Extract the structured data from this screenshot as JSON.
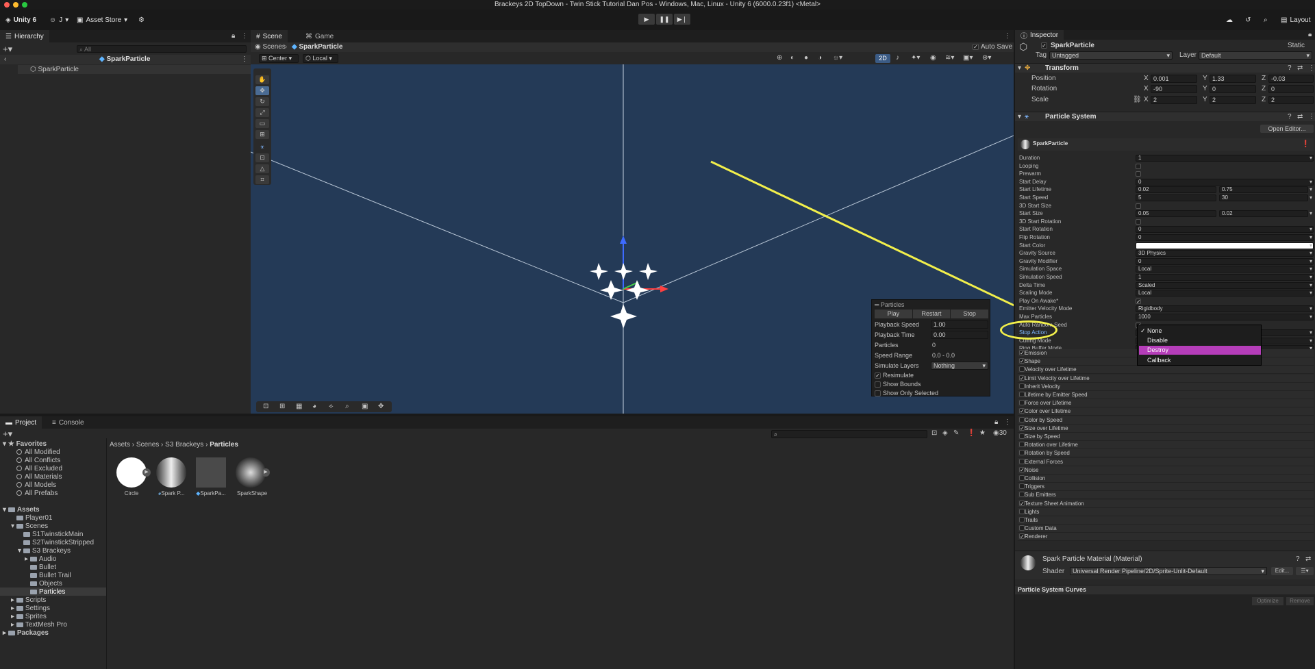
{
  "window": {
    "title": "Brackeys 2D TopDown - Twin Stick Tutorial Dan Pos - Windows, Mac, Linux - Unity 6 (6000.0.23f1) <Metal>"
  },
  "toolbar": {
    "app_label": "Unity 6",
    "account_label": "J",
    "asset_store_label": "Asset Store",
    "layout_label": "Layout"
  },
  "hierarchy": {
    "tab": "Hierarchy",
    "search_placeholder": "All",
    "scene_name": "SparkParticle",
    "item": "SparkParticle"
  },
  "scene": {
    "tabs": [
      "Scene",
      "Game"
    ],
    "breadcrumb_root": "Scenes",
    "breadcrumb_item": "SparkParticle",
    "auto_save": "Auto Save",
    "pivot": "Center",
    "space": "Local",
    "mode_2d": "2D"
  },
  "particles_overlay": {
    "title": "Particles",
    "buttons": [
      "Play",
      "Restart",
      "Stop"
    ],
    "rows": [
      {
        "label": "Playback Speed",
        "value": "1.00"
      },
      {
        "label": "Playback Time",
        "value": "0.00"
      },
      {
        "label": "Particles",
        "value": "0"
      },
      {
        "label": "Speed Range",
        "value": "0.0 - 0.0"
      },
      {
        "label": "Simulate Layers",
        "value": "Nothing"
      }
    ],
    "toggles": [
      {
        "label": "Resimulate",
        "checked": true
      },
      {
        "label": "Show Bounds",
        "checked": false
      },
      {
        "label": "Show Only Selected",
        "checked": false
      }
    ]
  },
  "project": {
    "tabs": [
      "Project",
      "Console"
    ],
    "search_count": "30",
    "favorites_label": "Favorites",
    "favorites": [
      "All Modified",
      "All Conflicts",
      "All Excluded",
      "All Materials",
      "All Models",
      "All Prefabs"
    ],
    "assets_label": "Assets",
    "tree": [
      "Player01",
      "Scenes",
      "S1TwinstickMain",
      "S2TwinstickStripped",
      "S3 Brackeys",
      "Audio",
      "Bullet",
      "Bullet Trail",
      "Objects",
      "Particles",
      "Scripts",
      "Settings",
      "Sprites",
      "TextMesh Pro"
    ],
    "packages_label": "Packages",
    "breadcrumb": [
      "Assets",
      "Scenes",
      "S3 Brackeys",
      "Particles"
    ],
    "assets": [
      "Circle",
      "Spark P...",
      "SparkPa...",
      "SparkShape"
    ]
  },
  "inspector": {
    "tab": "Inspector",
    "object_name": "SparkParticle",
    "static_label": "Static",
    "tag_label": "Tag",
    "tag_value": "Untagged",
    "layer_label": "Layer",
    "layer_value": "Default",
    "transform": {
      "title": "Transform",
      "rows": [
        {
          "label": "Position",
          "x": "0.001",
          "y": "1.33",
          "z": "-0.03"
        },
        {
          "label": "Rotation",
          "x": "-90",
          "y": "0",
          "z": "0"
        },
        {
          "label": "Scale",
          "x": "2",
          "y": "2",
          "z": "2"
        }
      ]
    },
    "particle_system": {
      "title": "Particle System",
      "open_editor": "Open Editor...",
      "sub_name": "SparkParticle",
      "props": [
        {
          "label": "Duration",
          "value": "1"
        },
        {
          "label": "Looping",
          "value": ""
        },
        {
          "label": "Prewarm",
          "value": ""
        },
        {
          "label": "Start Delay",
          "value": "0"
        },
        {
          "label": "Start Lifetime",
          "value": "0.02",
          "value2": "0.75"
        },
        {
          "label": "Start Speed",
          "value": "5",
          "value2": "30"
        },
        {
          "label": "3D Start Size",
          "value": ""
        },
        {
          "label": "Start Size",
          "value": "0.05",
          "value2": "0.02"
        },
        {
          "label": "3D Start Rotation",
          "value": ""
        },
        {
          "label": "Start Rotation",
          "value": "0"
        },
        {
          "label": "Flip Rotation",
          "value": "0"
        },
        {
          "label": "Start Color",
          "value": ""
        },
        {
          "label": "Gravity Source",
          "value": "3D Physics"
        },
        {
          "label": "Gravity Modifier",
          "value": "0"
        },
        {
          "label": "Simulation Space",
          "value": "Local"
        },
        {
          "label": "Simulation Speed",
          "value": "1"
        },
        {
          "label": "Delta Time",
          "value": "Scaled"
        },
        {
          "label": "Scaling Mode",
          "value": "Local"
        },
        {
          "label": "Play On Awake*",
          "value": "✓"
        },
        {
          "label": "Emitter Velocity Mode",
          "value": "Rigidbody"
        },
        {
          "label": "Max Particles",
          "value": "1000"
        },
        {
          "label": "Auto Random Seed",
          "value": "✓"
        },
        {
          "label": "Stop Action",
          "value": ""
        },
        {
          "label": "Culling Mode",
          "value": ""
        },
        {
          "label": "Ring Buffer Mode",
          "value": ""
        }
      ],
      "modules": [
        {
          "label": "Emission",
          "on": true
        },
        {
          "label": "Shape",
          "on": true
        },
        {
          "label": "Velocity over Lifetime",
          "on": false
        },
        {
          "label": "Limit Velocity over Lifetime",
          "on": true
        },
        {
          "label": "Inherit Velocity",
          "on": false
        },
        {
          "label": "Lifetime by Emitter Speed",
          "on": false
        },
        {
          "label": "Force over Lifetime",
          "on": false
        },
        {
          "label": "Color over Lifetime",
          "on": true
        },
        {
          "label": "Color by Speed",
          "on": false
        },
        {
          "label": "Size over Lifetime",
          "on": true
        },
        {
          "label": "Size by Speed",
          "on": false
        },
        {
          "label": "Rotation over Lifetime",
          "on": false
        },
        {
          "label": "Rotation by Speed",
          "on": false
        },
        {
          "label": "External Forces",
          "on": false
        },
        {
          "label": "Noise",
          "on": true
        },
        {
          "label": "Collision",
          "on": false
        },
        {
          "label": "Triggers",
          "on": false
        },
        {
          "label": "Sub Emitters",
          "on": false
        },
        {
          "label": "Texture Sheet Animation",
          "on": true
        },
        {
          "label": "Lights",
          "on": false
        },
        {
          "label": "Trails",
          "on": false
        },
        {
          "label": "Custom Data",
          "on": false
        },
        {
          "label": "Renderer",
          "on": true
        }
      ]
    },
    "dropdown": {
      "options": [
        "None",
        "Disable",
        "Destroy",
        "Callback"
      ],
      "checked": "None",
      "highlighted": "Destroy"
    },
    "material": {
      "title": "Spark Particle Material (Material)",
      "shader_label": "Shader",
      "shader_value": "Universal Render Pipeline/2D/Sprite-Unlit-Default",
      "edit": "Edit..."
    },
    "curves": {
      "title": "Particle System Curves",
      "optimize": "Optimize",
      "remove": "Remove"
    }
  },
  "colors": {
    "highlight": "#b53db9",
    "annotation": "#f2ef4b",
    "scene_bg": "#243a57"
  }
}
